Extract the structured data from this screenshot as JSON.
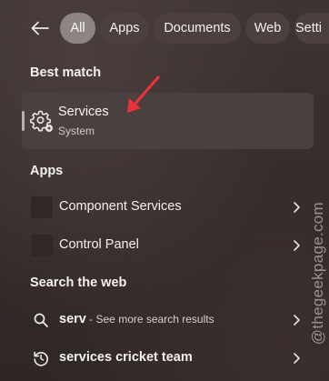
{
  "filters": {
    "back_icon": "back-arrow-icon",
    "tabs": [
      {
        "label": "All",
        "active": true
      },
      {
        "label": "Apps",
        "active": false
      },
      {
        "label": "Documents",
        "active": false
      },
      {
        "label": "Web",
        "active": false
      },
      {
        "label": "Setti",
        "active": false
      }
    ]
  },
  "best_match": {
    "heading": "Best match",
    "title": "Services",
    "subtitle": "System",
    "icon": "gear-icon"
  },
  "apps": {
    "heading": "Apps",
    "items": [
      {
        "label": "Component Services"
      },
      {
        "label": "Control Panel"
      }
    ]
  },
  "web": {
    "heading": "Search the web",
    "items": [
      {
        "query": "serv",
        "hint": " - See more search results",
        "icon": "search-icon"
      },
      {
        "query": "services cricket team",
        "hint": "",
        "icon": "history-icon"
      }
    ]
  },
  "annotation": {
    "arrow_color": "#e8333a"
  },
  "watermark": "@thegeekpage.com",
  "colors": {
    "active_pill": "#8d8583",
    "pill": "#4b403f",
    "card": "#4a403f"
  }
}
